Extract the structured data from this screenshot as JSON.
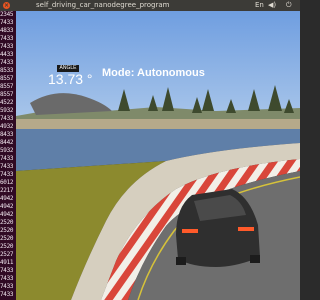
{
  "window": {
    "title": "self_driving_car_nanodegree_program",
    "close_glyph": "×",
    "tray": [
      "En",
      "◀)",
      "⏻"
    ]
  },
  "terminal": {
    "lines": [
      "2345",
      "7433",
      "4833",
      "7433",
      "7433",
      "4433",
      "7433",
      "8533",
      "8557",
      "8557",
      "8557",
      "4522",
      "5932",
      "7433",
      "4932",
      "8433",
      "8442",
      "5932",
      "7433",
      "7433",
      "7433",
      "6012",
      "2217",
      "4942",
      "4942",
      "4942",
      "2520",
      "2520",
      "2520",
      "2520",
      "2527",
      "4911",
      "7433",
      "7433",
      "7433",
      "7433"
    ]
  },
  "hud": {
    "angle_label": "ANGLE",
    "angle_value": "13.73 °",
    "mode_text": "Mode: Autonomous"
  },
  "colors": {
    "sky": "#5b8fd6",
    "lake": "#5f7fa8",
    "grass": "#8c8a2e",
    "road": "#6e6e6e",
    "curb_red": "#d9463a",
    "car": "#3a3a3a"
  }
}
